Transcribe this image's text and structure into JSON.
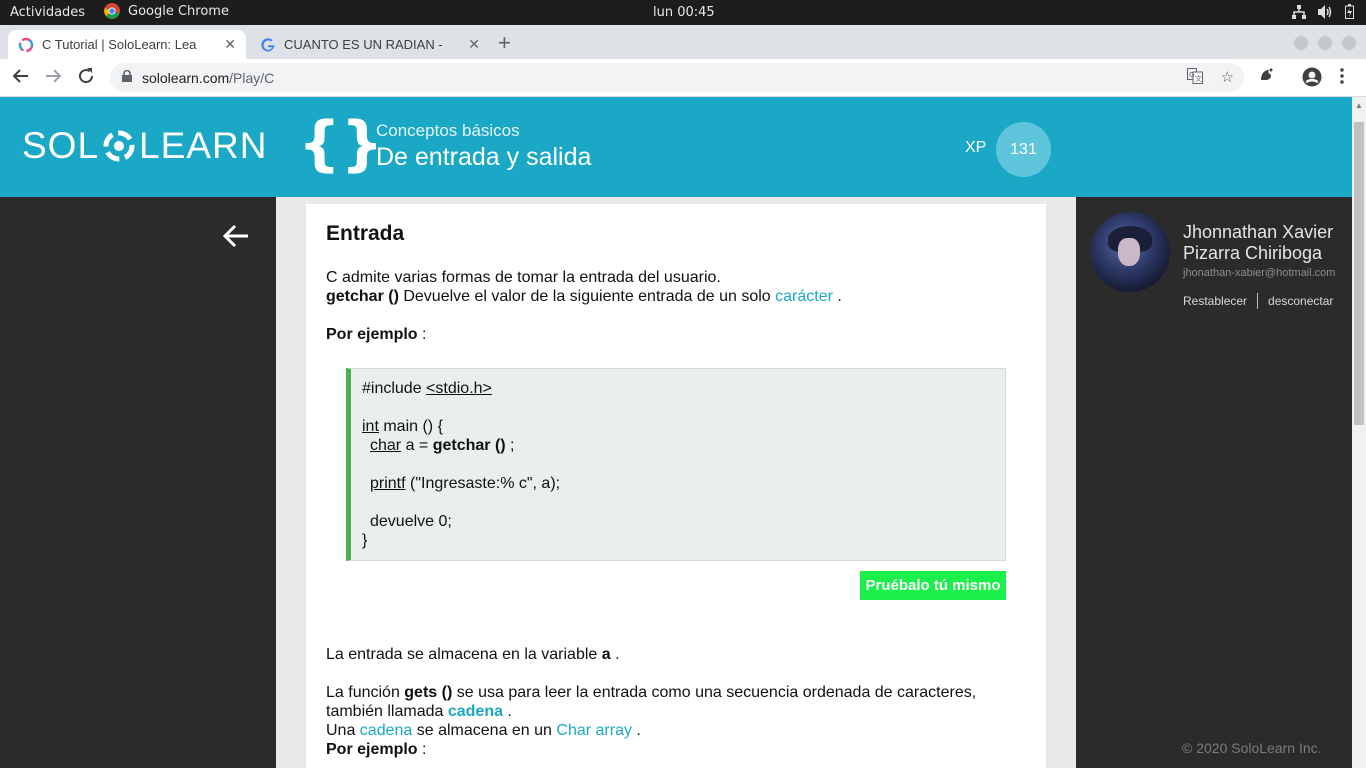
{
  "os_bar": {
    "activities": "Actividades",
    "app_name": "Google Chrome",
    "clock": "lun 00:45"
  },
  "browser": {
    "tabs": [
      {
        "title": "C Tutorial | SoloLearn: Lea",
        "active": true
      },
      {
        "title": "CUANTO ES UN RADIAN -",
        "active": false
      }
    ],
    "url_host": "sololearn.com",
    "url_path": "/Play/C"
  },
  "header": {
    "logo_left": "SOL",
    "logo_right": "LEARN",
    "course_icon": "{}",
    "module": "Conceptos básicos",
    "lesson": "De entrada y salida",
    "xp_label": "XP",
    "xp_value": "131",
    "bg_color": "#1ba8c6"
  },
  "lesson": {
    "heading": "Entrada",
    "p1": "C admite varias formas de tomar la entrada del usuario.",
    "p2_bold": "getchar ()",
    "p2_text": " Devuelve el valor de la siguiente entrada de un solo ",
    "p2_link": "carácter",
    "p2_end": " .",
    "example_bold": "Por ejemplo",
    "example_end": " :",
    "code": {
      "include_kw": "#include ",
      "include_hdr": "<stdio.h>",
      "int_kw": "int",
      "main_sig": " main () {",
      "char_kw": "char",
      "assign": " a = ",
      "getchar_call": "getchar ()",
      "semicolon": " ;",
      "printf_kw": "printf",
      "printf_args": " (\"Ingresaste:% c\", a);",
      "return_line": "devuelve 0;",
      "close_brace": "}"
    },
    "try_button": "Pruébalo tú mismo",
    "p3_text": "La entrada se almacena en la variable ",
    "p3_bold": "a",
    "p3_end": " .",
    "p4_text1": "La función ",
    "p4_bold": "gets ()",
    "p4_text2": " se usa para leer la entrada como una secuencia ordenada de caracteres,",
    "p4_line2": "también llamada ",
    "p4_link_bold": "cadena",
    "p4_end": " .",
    "p5_text1": "Una ",
    "p5_link1": "cadena",
    "p5_text2": " se almacena en un ",
    "p5_link2": "Char array",
    "p5_end": " .",
    "example2_bold": "Por ejemplo",
    "example2_end": " :",
    "accent_color": "#1ba8c6",
    "button_color": "#1bf04a"
  },
  "profile": {
    "name": "Jhonnathan Xavier Pizarra Chiriboga",
    "email": "jhonathan-xabier@hotmail.com",
    "reset": "Restablecer",
    "logout": "desconectar"
  },
  "footer": "© 2020 SoloLearn Inc."
}
